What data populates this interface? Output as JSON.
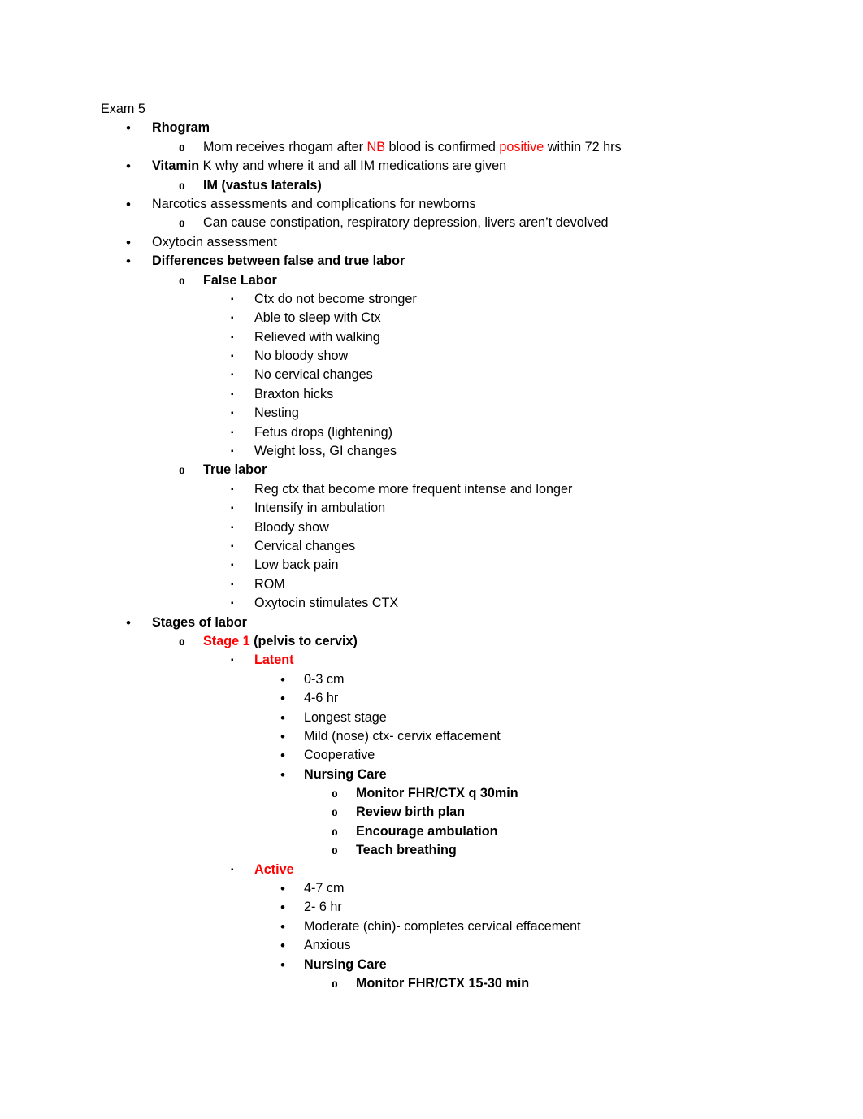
{
  "document": {
    "title": "Exam 5",
    "colors": {
      "text": "#000000",
      "accent_red": "#FF0000",
      "background": "#FFFFFF"
    },
    "markers": {
      "level1": "•",
      "level2": "o",
      "level3": "▪",
      "level4": "•",
      "level5": "o"
    },
    "lines": [
      {
        "id": "l0",
        "level": 0,
        "text": "Exam 5",
        "bold": false
      },
      {
        "id": "l1",
        "level": 1,
        "text": "Rhogram",
        "bold": true
      },
      {
        "id": "l2",
        "level": 2,
        "bold": false,
        "runs": [
          {
            "text": "Mom receives rhogam after ",
            "color": "black"
          },
          {
            "text": "NB",
            "color": "red"
          },
          {
            "text": " blood is confirmed ",
            "color": "black"
          },
          {
            "text": "positive",
            "color": "red"
          },
          {
            "text": " within 72 hrs",
            "color": "black"
          }
        ]
      },
      {
        "id": "l3",
        "level": 1,
        "bold": false,
        "runs": [
          {
            "text": "Vitamin",
            "color": "black",
            "bold": true
          },
          {
            "text": " K why and where it and all IM medications are given",
            "color": "black"
          }
        ]
      },
      {
        "id": "l4",
        "level": 2,
        "text": "IM (vastus laterals)",
        "bold": true
      },
      {
        "id": "l5",
        "level": 1,
        "text": "Narcotics assessments and complications for newborns",
        "bold": false
      },
      {
        "id": "l6",
        "level": 2,
        "text": "Can cause constipation, respiratory depression, livers aren’t devolved",
        "bold": false
      },
      {
        "id": "l7",
        "level": 1,
        "text": "Oxytocin assessment",
        "bold": false
      },
      {
        "id": "l8",
        "level": 1,
        "text": "Differences between false and true labor",
        "bold": true
      },
      {
        "id": "l9",
        "level": 2,
        "text": "False Labor",
        "bold": true
      },
      {
        "id": "l10",
        "level": 3,
        "text": "Ctx do not become stronger",
        "bold": false
      },
      {
        "id": "l11",
        "level": 3,
        "text": "Able to sleep with Ctx",
        "bold": false
      },
      {
        "id": "l12",
        "level": 3,
        "text": "Relieved with walking",
        "bold": false
      },
      {
        "id": "l13",
        "level": 3,
        "text": "No bloody show",
        "bold": false
      },
      {
        "id": "l14",
        "level": 3,
        "text": "No cervical changes",
        "bold": false
      },
      {
        "id": "l15",
        "level": 3,
        "text": "Braxton hicks",
        "bold": false
      },
      {
        "id": "l16",
        "level": 3,
        "text": "Nesting",
        "bold": false
      },
      {
        "id": "l17",
        "level": 3,
        "text": "Fetus drops (lightening)",
        "bold": false
      },
      {
        "id": "l18",
        "level": 3,
        "text": "Weight loss, GI changes",
        "bold": false
      },
      {
        "id": "l19",
        "level": 2,
        "text": "True labor",
        "bold": true
      },
      {
        "id": "l20",
        "level": 3,
        "text": "Reg ctx that become more frequent intense and longer",
        "bold": false
      },
      {
        "id": "l21",
        "level": 3,
        "text": "Intensify in ambulation",
        "bold": false
      },
      {
        "id": "l22",
        "level": 3,
        "text": "Bloody show",
        "bold": false
      },
      {
        "id": "l23",
        "level": 3,
        "text": "Cervical changes",
        "bold": false
      },
      {
        "id": "l24",
        "level": 3,
        "text": "Low back pain",
        "bold": false
      },
      {
        "id": "l25",
        "level": 3,
        "text": "ROM",
        "bold": false
      },
      {
        "id": "l26",
        "level": 3,
        "text": "Oxytocin stimulates CTX",
        "bold": false
      },
      {
        "id": "l27",
        "level": 1,
        "text": "Stages of labor",
        "bold": true
      },
      {
        "id": "l28",
        "level": 2,
        "bold": true,
        "runs": [
          {
            "text": "Stage 1",
            "color": "red",
            "bold": true
          },
          {
            "text": " (pelvis to cervix)",
            "color": "black",
            "bold": true
          }
        ]
      },
      {
        "id": "l29",
        "level": 3,
        "text": "Latent",
        "bold": true,
        "color": "red"
      },
      {
        "id": "l30",
        "level": 4,
        "text": "0-3 cm",
        "bold": false
      },
      {
        "id": "l31",
        "level": 4,
        "text": "4-6 hr",
        "bold": false
      },
      {
        "id": "l32",
        "level": 4,
        "text": "Longest stage",
        "bold": false
      },
      {
        "id": "l33",
        "level": 4,
        "text": "Mild (nose) ctx- cervix effacement",
        "bold": false
      },
      {
        "id": "l34",
        "level": 4,
        "text": "Cooperative",
        "bold": false
      },
      {
        "id": "l35",
        "level": 4,
        "text": "Nursing Care",
        "bold": true
      },
      {
        "id": "l36",
        "level": 5,
        "text": "Monitor FHR/CTX q 30min",
        "bold": true
      },
      {
        "id": "l37",
        "level": 5,
        "text": "Review birth plan",
        "bold": true
      },
      {
        "id": "l38",
        "level": 5,
        "text": "Encourage ambulation",
        "bold": true
      },
      {
        "id": "l39",
        "level": 5,
        "text": "Teach breathing",
        "bold": true
      },
      {
        "id": "l40",
        "level": 3,
        "text": "Active",
        "bold": true,
        "color": "red"
      },
      {
        "id": "l41",
        "level": 4,
        "text": "4-7 cm",
        "bold": false
      },
      {
        "id": "l42",
        "level": 4,
        "text": "2- 6 hr",
        "bold": false
      },
      {
        "id": "l43",
        "level": 4,
        "text": "Moderate (chin)- completes cervical effacement",
        "bold": false
      },
      {
        "id": "l44",
        "level": 4,
        "text": "Anxious",
        "bold": false
      },
      {
        "id": "l45",
        "level": 4,
        "text": "Nursing Care",
        "bold": true
      },
      {
        "id": "l46",
        "level": 5,
        "text": "Monitor FHR/CTX 15-30 min",
        "bold": true
      }
    ]
  }
}
